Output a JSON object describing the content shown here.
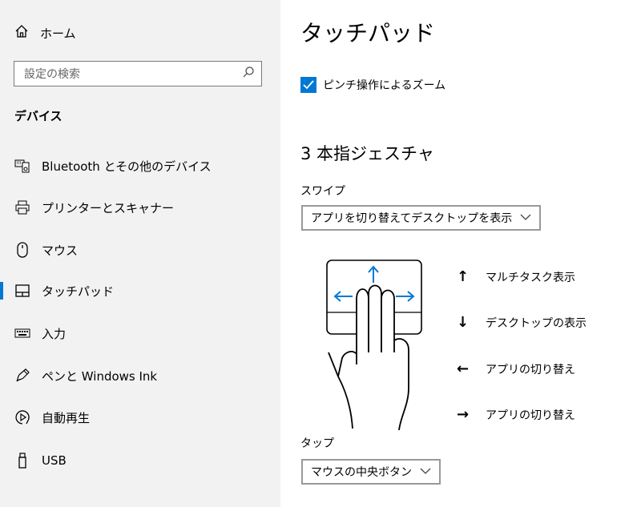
{
  "sidebar": {
    "home_label": "ホーム",
    "search_placeholder": "設定の検索",
    "section_title": "デバイス",
    "items": [
      {
        "label": "Bluetooth とその他のデバイス",
        "icon": "devices-icon"
      },
      {
        "label": "プリンターとスキャナー",
        "icon": "printer-icon"
      },
      {
        "label": "マウス",
        "icon": "mouse-icon"
      },
      {
        "label": "タッチパッド",
        "icon": "touchpad-icon",
        "selected": true
      },
      {
        "label": "入力",
        "icon": "keyboard-icon"
      },
      {
        "label": "ペンと Windows Ink",
        "icon": "pen-icon"
      },
      {
        "label": "自動再生",
        "icon": "autoplay-icon"
      },
      {
        "label": "USB",
        "icon": "usb-icon"
      }
    ]
  },
  "main": {
    "title": "タッチパッド",
    "pinch_zoom_label": "ピンチ操作によるズーム",
    "pinch_zoom_checked": true,
    "three_finger_title": "3 本指ジェスチャ",
    "swipe_label": "スワイプ",
    "swipe_value": "アプリを切り替えてデスクトップを表示",
    "gestures": [
      {
        "arrow": "↑",
        "label": "マルチタスク表示"
      },
      {
        "arrow": "↓",
        "label": "デスクトップの表示"
      },
      {
        "arrow": "←",
        "label": "アプリの切り替え"
      },
      {
        "arrow": "→",
        "label": "アプリの切り替え"
      }
    ],
    "tap_label": "タップ",
    "tap_value": "マウスの中央ボタン"
  },
  "colors": {
    "accent": "#0078d4",
    "sidebar_bg": "#f2f2f2"
  }
}
